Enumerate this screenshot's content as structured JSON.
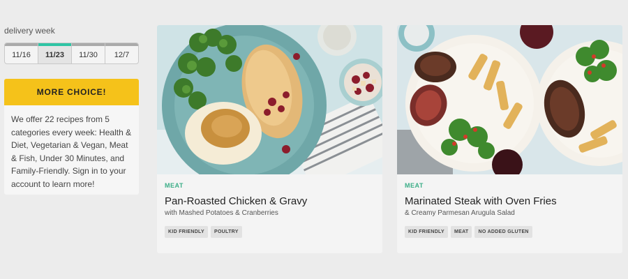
{
  "delivery": {
    "label": "delivery week",
    "weeks": [
      "11/16",
      "11/23",
      "11/30",
      "12/7"
    ],
    "selected_week": "11/23"
  },
  "promo": {
    "button_label": "MORE CHOICE!",
    "description": "We offer 22 recipes from 5 categories every week: Health & Diet, Vegetarian & Vegan, Meat & Fish, Under 30 Minutes, and Family-Friendly. Sign in to your account to learn more!"
  },
  "recipes": [
    {
      "category": "MEAT",
      "title": "Pan-Roasted Chicken & Gravy",
      "subtitle": "with Mashed Potatoes & Cranberries",
      "tags": [
        "KID FRIENDLY",
        "POULTRY"
      ]
    },
    {
      "category": "MEAT",
      "title": "Marinated Steak with Oven Fries",
      "subtitle": "& Creamy Parmesan Arugula Salad",
      "tags": [
        "KID FRIENDLY",
        "MEAT",
        "NO ADDED GLUTEN"
      ]
    }
  ],
  "colors": {
    "accent_yellow": "#f5c21a",
    "selected_week_bar": "#2fc4a4",
    "category_green": "#3cae88"
  }
}
